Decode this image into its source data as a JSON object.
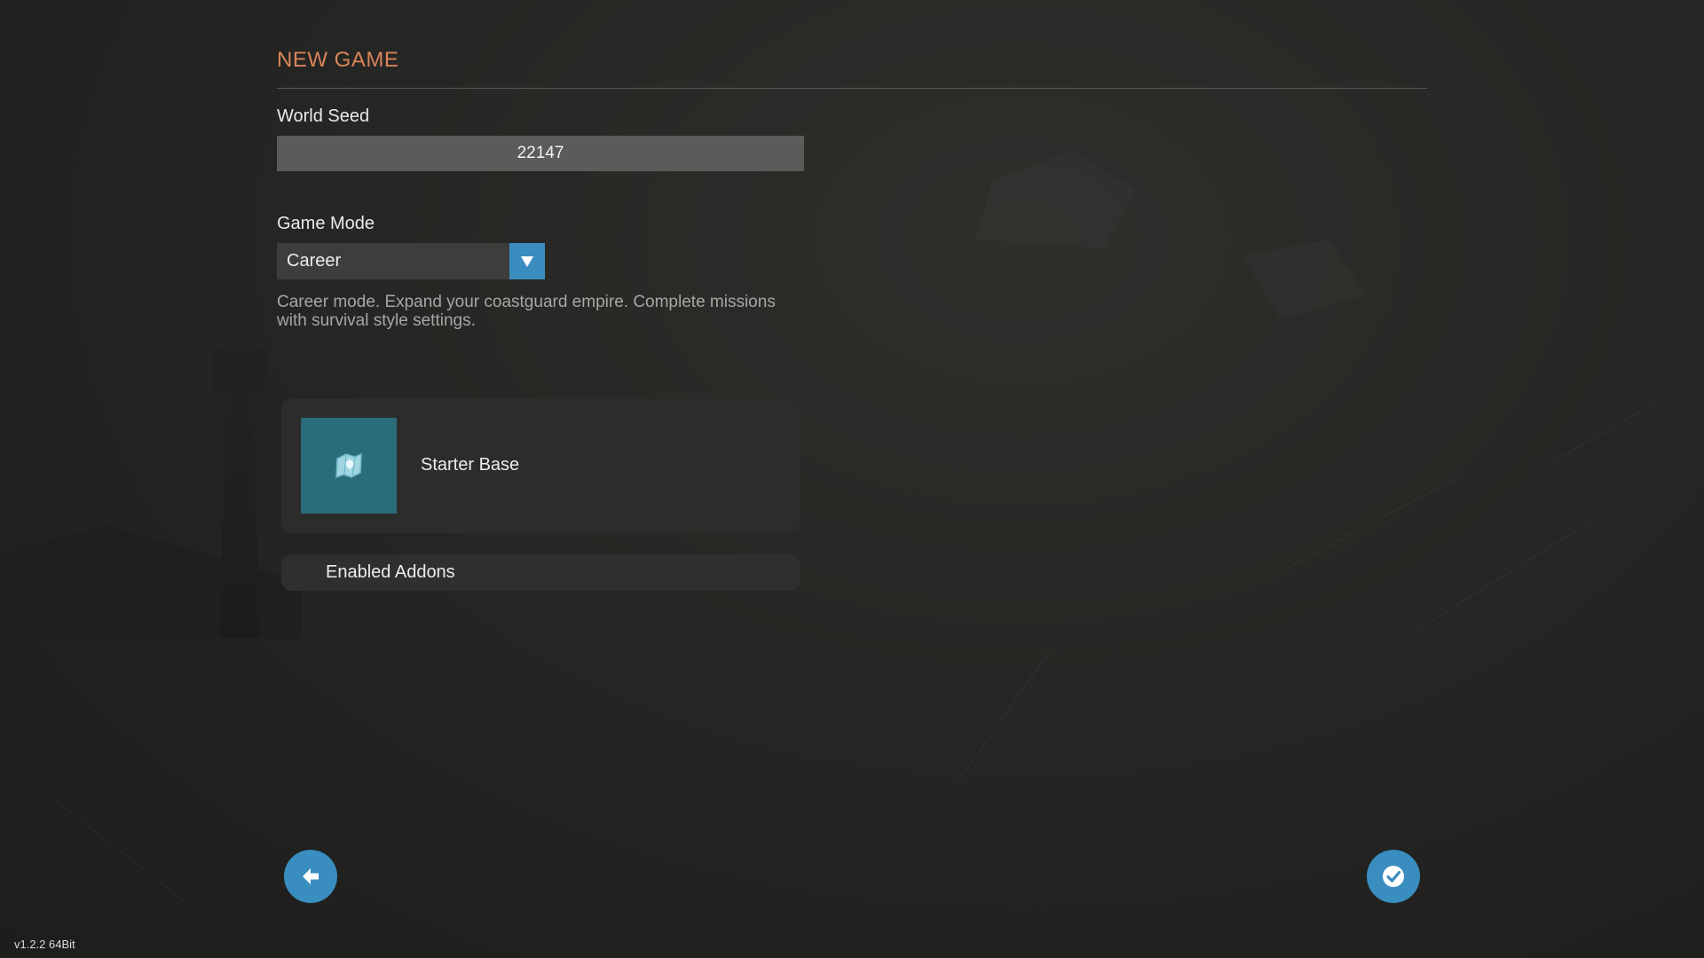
{
  "header": {
    "title": "NEW GAME"
  },
  "world_seed": {
    "label": "World Seed",
    "value": "22147"
  },
  "game_mode": {
    "label": "Game Mode",
    "selected": "Career",
    "description": "Career mode. Expand your coastguard empire. Complete missions with survival style settings."
  },
  "starter_base": {
    "label": "Starter Base",
    "icon": "map-pin-icon"
  },
  "addons": {
    "label": "Enabled Addons"
  },
  "footer": {
    "back_icon": "back-arrow-icon",
    "confirm_icon": "checkmark-icon",
    "version": "v1.2.2 64Bit"
  },
  "colors": {
    "accent": "#3a8dbf",
    "title": "#d9845a",
    "background": "#262624",
    "input_bg": "#5b5b59",
    "card_bg": "#2c2c2a",
    "thumb_bg": "#2b6c7b"
  }
}
